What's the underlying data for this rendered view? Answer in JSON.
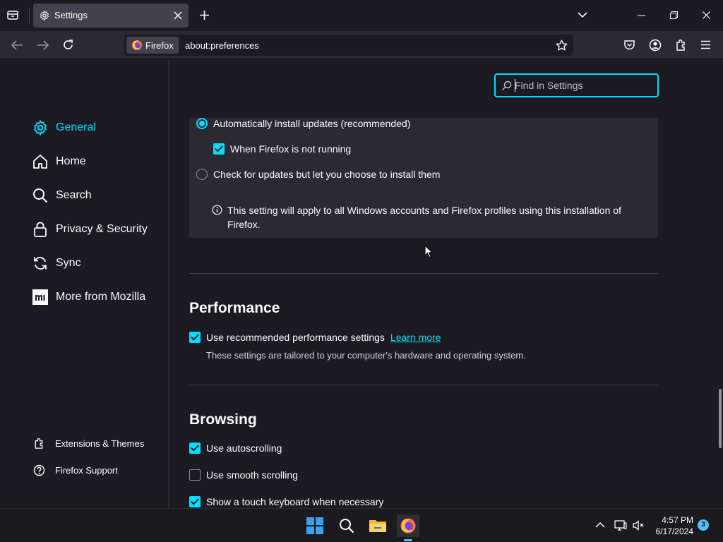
{
  "tab": {
    "title": "Settings"
  },
  "urlbar": {
    "identity_label": "Firefox",
    "url": "about:preferences"
  },
  "sidebar": {
    "items": [
      {
        "label": "General",
        "icon": "gear-icon",
        "selected": true
      },
      {
        "label": "Home",
        "icon": "home-icon"
      },
      {
        "label": "Search",
        "icon": "search-icon"
      },
      {
        "label": "Privacy & Security",
        "icon": "lock-icon"
      },
      {
        "label": "Sync",
        "icon": "sync-icon"
      },
      {
        "label": "More from Mozilla",
        "icon": "mozilla-icon"
      }
    ],
    "footer": [
      {
        "label": "Extensions & Themes",
        "icon": "puzzle-icon"
      },
      {
        "label": "Firefox Support",
        "icon": "help-icon"
      }
    ]
  },
  "search": {
    "placeholder": "Find in Settings"
  },
  "updates": {
    "auto_install_label": "Automatically install updates (recommended)",
    "when_not_running_label": "When Firefox is not running",
    "check_only_label": "Check for updates but let you choose to install them",
    "info": "This setting will apply to all Windows accounts and Firefox profiles using this installation of Firefox."
  },
  "performance": {
    "title": "Performance",
    "recommended_label": "Use recommended performance settings",
    "learn_more": "Learn more",
    "description": "These settings are tailored to your computer's hardware and operating system."
  },
  "browsing": {
    "title": "Browsing",
    "autoscroll_label": "Use autoscrolling",
    "smooth_label": "Use smooth scrolling",
    "touch_keyboard_label": "Show a touch keyboard when necessary"
  },
  "taskbar": {
    "time": "4:57 PM",
    "date": "6/17/2024",
    "notification_count": "3"
  },
  "colors": {
    "accent": "#00ddff",
    "bg": "#1c1b22",
    "panel": "#2b2a33"
  }
}
